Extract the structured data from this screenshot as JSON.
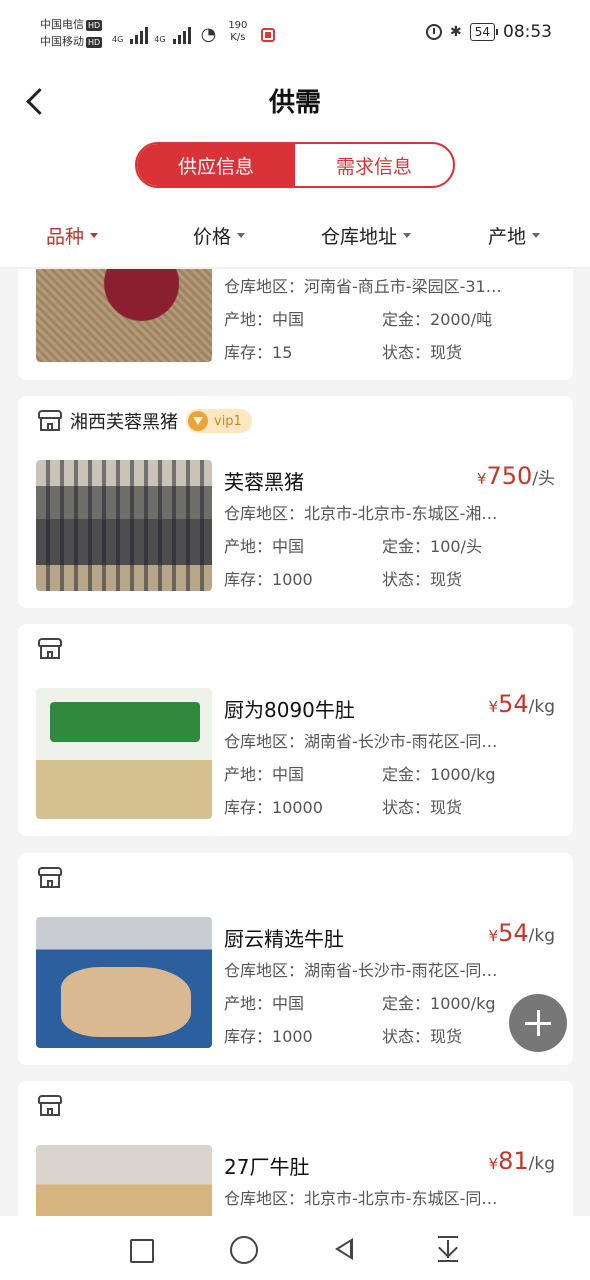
{
  "status_bar": {
    "carrier1": "中国电信",
    "carrier2": "中国移动",
    "hd": "HD",
    "net1": "4G",
    "net2": "4G",
    "speed_value": "190",
    "speed_unit": "K/s",
    "battery": "54",
    "time": "08:53",
    "bluetooth_glyph": "✱"
  },
  "header": {
    "title": "供需"
  },
  "segment": {
    "tab_supply": "供应信息",
    "tab_demand": "需求信息",
    "active": "supply"
  },
  "filters": {
    "variety": "品种",
    "price": "价格",
    "warehouse": "仓库地址",
    "origin": "产地"
  },
  "labels": {
    "warehouse_area": "仓库地区：",
    "origin": "产地：",
    "deposit": "定金：",
    "stock": "库存：",
    "status": "状态：",
    "currency": "¥"
  },
  "cards": [
    {
      "store": "",
      "vip": "",
      "name": "",
      "price": "",
      "unit": "",
      "warehouse_area": "河南省-商丘市-梁园区-31…",
      "origin": "中国",
      "deposit": "2000/吨",
      "stock": "15",
      "status": "现货",
      "thumb": "meat"
    },
    {
      "store": "湘西芙蓉黑猪",
      "vip": "vip1",
      "name": "芙蓉黑猪",
      "price": "750",
      "unit": "/头",
      "warehouse_area": "北京市-北京市-东城区-湘…",
      "origin": "中国",
      "deposit": "100/头",
      "stock": "1000",
      "status": "现货",
      "thumb": "pigs"
    },
    {
      "store": "",
      "vip": "",
      "name": "厨为8090牛肚",
      "price": "54",
      "unit": "/kg",
      "warehouse_area": "湖南省-长沙市-雨花区-同…",
      "origin": "中国",
      "deposit": "1000/kg",
      "stock": "10000",
      "status": "现货",
      "thumb": "tripe1"
    },
    {
      "store": "",
      "vip": "",
      "name": "厨云精选牛肚",
      "price": "54",
      "unit": "/kg",
      "warehouse_area": "湖南省-长沙市-雨花区-同…",
      "origin": "中国",
      "deposit": "1000/kg",
      "stock": "1000",
      "status": "现货",
      "thumb": "tripe2"
    },
    {
      "store": "",
      "vip": "",
      "name": "27厂牛肚",
      "price": "81",
      "unit": "/kg",
      "warehouse_area": "北京市-北京市-东城区-同…",
      "origin": "",
      "deposit": "",
      "stock": "",
      "status": "",
      "thumb": "tripe3"
    }
  ],
  "fab": {
    "icon": "plus-icon"
  },
  "colors": {
    "accent": "#d93338",
    "price": "#c0392b"
  }
}
